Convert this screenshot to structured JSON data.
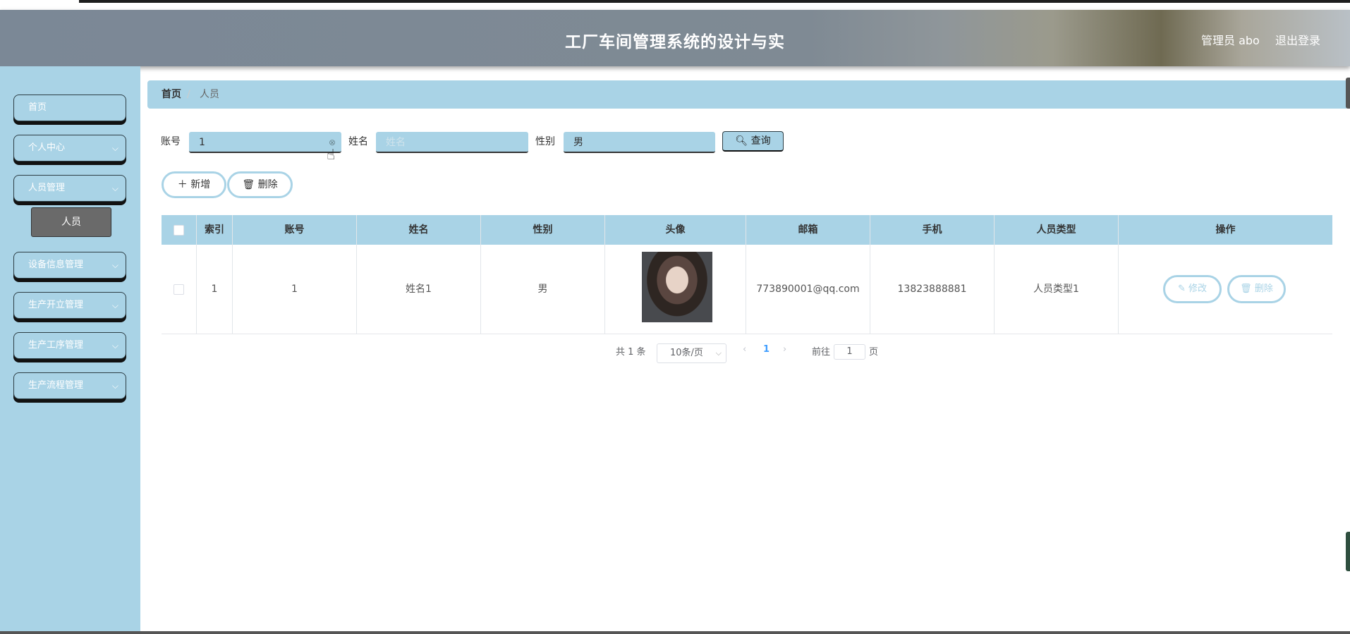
{
  "header": {
    "title": "工厂车间管理系统的设计与实",
    "user_label": "管理员 abo",
    "logout_label": "退出登录"
  },
  "sidebar": {
    "items": [
      {
        "label": "首页"
      },
      {
        "label": "个人中心"
      },
      {
        "label": "人员管理",
        "sub": [
          "人员"
        ]
      },
      {
        "label": "设备信息管理"
      },
      {
        "label": "生产开立管理"
      },
      {
        "label": "生产工序管理"
      },
      {
        "label": "生产流程管理"
      }
    ]
  },
  "breadcrumb": {
    "home": "首页",
    "separator": "/",
    "current": "人员"
  },
  "filters": {
    "account_label": "账号",
    "account_value": "1",
    "name_label": "姓名",
    "name_placeholder": "姓名",
    "gender_label": "性别",
    "gender_value": "男",
    "search_label": "查询"
  },
  "actions": {
    "add_label": "新增",
    "delete_label": "删除"
  },
  "table": {
    "headers": [
      "索引",
      "账号",
      "姓名",
      "性别",
      "头像",
      "邮箱",
      "手机",
      "人员类型",
      "操作"
    ],
    "rows": [
      {
        "index": "1",
        "account": "1",
        "name": "姓名1",
        "gender": "男",
        "email": "773890001@qq.com",
        "phone": "13823888881",
        "type": "人员类型1",
        "edit": "修改",
        "delete": "删除"
      }
    ]
  },
  "pagination": {
    "total_text": "共 1 条",
    "page_size": "10条/页",
    "current_page": "1",
    "goto_label": "前往",
    "goto_value": "1",
    "page_suffix": "页"
  },
  "colors": {
    "accent": "#a9d3e6",
    "dark": "#111111",
    "active_page": "#409eff"
  }
}
